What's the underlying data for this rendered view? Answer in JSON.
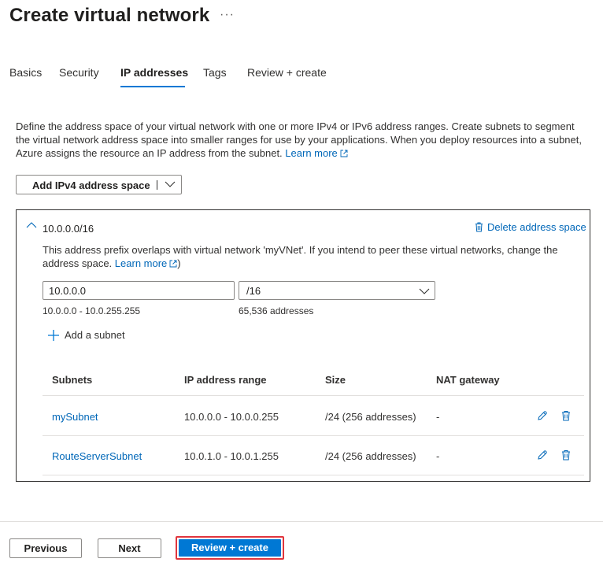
{
  "header": {
    "title": "Create virtual network",
    "more": "···"
  },
  "tabs": [
    {
      "label": "Basics"
    },
    {
      "label": "Security"
    },
    {
      "label": "IP addresses"
    },
    {
      "label": "Tags"
    },
    {
      "label": "Review + create"
    }
  ],
  "active_tab": "IP addresses",
  "description": {
    "text": "Define the address space of your virtual network with one or more IPv4 or IPv6 address ranges. Create subnets to segment the virtual network address space into smaller ranges for use by your applications. When you deploy resources into a subnet, Azure assigns the resource an IP address from the subnet.",
    "link": "Learn more"
  },
  "add_space_button": {
    "label": "Add IPv4 address space"
  },
  "address_space": {
    "cidr": "10.0.0.0/16",
    "delete_label": "Delete address space",
    "warning_text": "This address prefix overlaps with virtual network 'myVNet'. If you intend to peer these virtual networks, change the address space.",
    "warning_link": "Learn more",
    "warning_tail": ")",
    "address_value": "10.0.0.0",
    "prefix_value": "/16",
    "range_text": "10.0.0.0 - 10.0.255.255",
    "count_text": "65,536 addresses",
    "add_subnet_label": "Add a subnet"
  },
  "subnets_table": {
    "headers": {
      "subnets": "Subnets",
      "range": "IP address range",
      "size": "Size",
      "nat": "NAT gateway"
    },
    "rows": [
      {
        "name": "mySubnet",
        "range": "10.0.0.0 - 10.0.0.255",
        "size": "/24 (256 addresses)",
        "nat": "-"
      },
      {
        "name": "RouteServerSubnet",
        "range": "10.0.1.0 - 10.0.1.255",
        "size": "/24 (256 addresses)",
        "nat": "-"
      }
    ]
  },
  "footer": {
    "previous": "Previous",
    "next": "Next",
    "review_create": "Review + create"
  },
  "colors": {
    "accent": "#0078d4",
    "link": "#0067b8",
    "highlight": "#e0353d"
  },
  "icons": [
    "ellipsis-icon",
    "external-link-icon",
    "chevron-down-icon",
    "chevron-up-icon",
    "trash-icon",
    "plus-icon",
    "pencil-icon"
  ]
}
